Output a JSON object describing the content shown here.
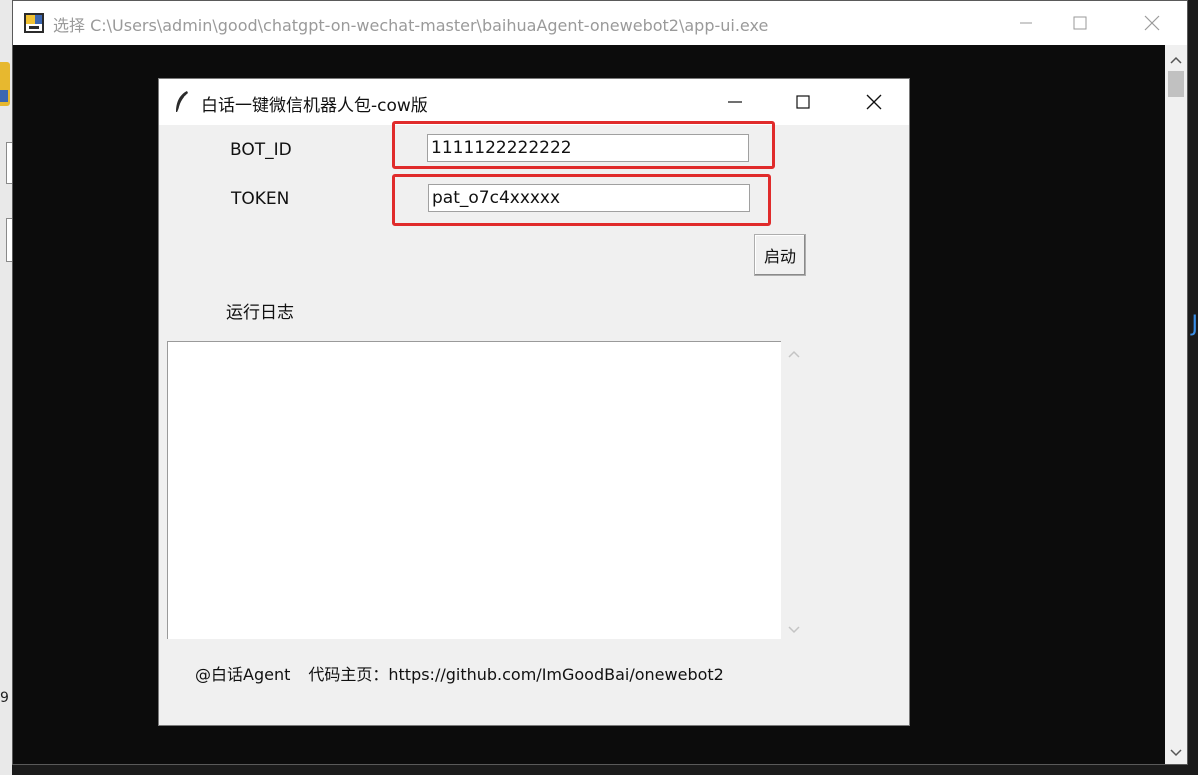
{
  "console_window": {
    "title": "选择 C:\\Users\\admin\\good\\chatgpt-on-wechat-master\\baihuaAgent-onewebot2\\app-ui.exe",
    "icon": "console-app-icon"
  },
  "background": {
    "left_digit": "9",
    "right_glyph": "J"
  },
  "app_window": {
    "title": "白话一键微信机器人包-cow版",
    "icon": "feather-icon"
  },
  "form": {
    "bot_id_label": "BOT_ID",
    "bot_id_value": "1111122222222",
    "token_label": "TOKEN",
    "token_value": "pat_o7c4xxxxx",
    "start_button": "启动"
  },
  "log": {
    "label": "运行日志",
    "content": ""
  },
  "footer": {
    "author": "@白话Agent",
    "homepage": "代码主页：https://github.com/ImGoodBai/onewebot2"
  },
  "colors": {
    "highlight": "#e02b2b",
    "console_bg": "#0c0c0c",
    "window_bg": "#f0f0f0"
  }
}
